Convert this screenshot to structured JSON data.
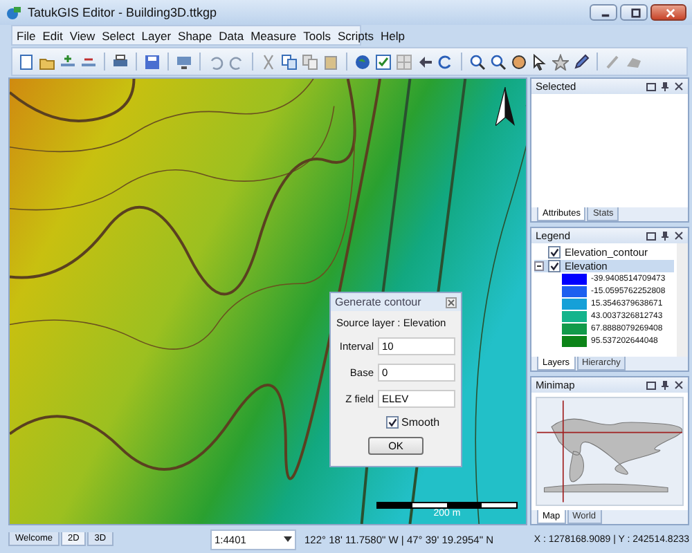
{
  "window": {
    "title": "TatukGIS Editor - Building3D.ttkgp"
  },
  "menu": [
    {
      "label": "File"
    },
    {
      "label": "Edit"
    },
    {
      "label": "View"
    },
    {
      "label": "Select"
    },
    {
      "label": "Layer"
    },
    {
      "label": "Shape"
    },
    {
      "label": "Data"
    },
    {
      "label": "Measure"
    },
    {
      "label": "Tools"
    },
    {
      "label": "Scripts"
    },
    {
      "label": "Help"
    }
  ],
  "map": {
    "scale_bar": "200 m"
  },
  "dialog": {
    "title": "Generate contour",
    "source": "Source layer : Elevation",
    "fields": [
      {
        "label": "Interval",
        "value": "10"
      },
      {
        "label": "Base",
        "value": "0"
      },
      {
        "label": "Z field",
        "value": "ELEV"
      }
    ],
    "smooth": {
      "label": "Smooth",
      "checked": true
    },
    "ok": "OK"
  },
  "selected_panel": {
    "title": "Selected",
    "tabs": [
      {
        "label": "Attributes",
        "selected": true
      },
      {
        "label": "Stats",
        "selected": false
      }
    ]
  },
  "legend_panel": {
    "title": "Legend",
    "layers": [
      {
        "name": "Elevation_contour",
        "checked": true
      },
      {
        "name": "Elevation",
        "checked": true,
        "classes": [
          {
            "label": "-39.9408514709473",
            "color": "#0000ff"
          },
          {
            "label": "-15.0595762252808",
            "color": "#1c5ff0"
          },
          {
            "label": "15.3546379638671",
            "color": "#16a0d8"
          },
          {
            "label": "43.0037326812743",
            "color": "#14b48c"
          },
          {
            "label": "67.8888079269408",
            "color": "#119a4a"
          },
          {
            "label": "95.537202644048",
            "color": "#0c8418"
          }
        ]
      }
    ],
    "tabs": [
      {
        "label": "Layers",
        "selected": true
      },
      {
        "label": "Hierarchy",
        "selected": false
      }
    ]
  },
  "minimap_panel": {
    "title": "Minimap",
    "tabs": [
      {
        "label": "Map",
        "selected": true
      },
      {
        "label": "World",
        "selected": false
      }
    ]
  },
  "status_bar": {
    "view_tabs": [
      {
        "label": "Welcome",
        "selected": false
      },
      {
        "label": "2D",
        "selected": true
      },
      {
        "label": "3D",
        "selected": false
      }
    ],
    "scale": "1:4401",
    "geo": "122° 18' 11.7580\" W | 47° 39' 19.2954\" N",
    "xy": "X : 1278168.9089 | Y : 242514.8233"
  }
}
